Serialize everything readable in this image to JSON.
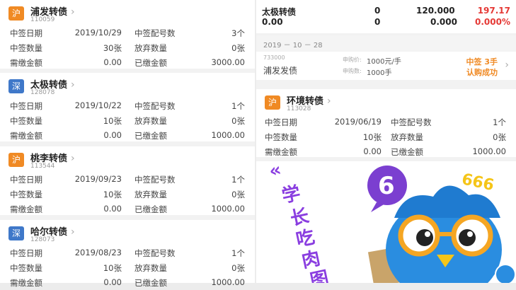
{
  "left_cards": [
    {
      "exchange": "沪",
      "name": "浦发转债",
      "code": "110059",
      "labels": [
        "中签日期",
        "中签配号数",
        "中签数量",
        "放弃数量",
        "需缴金额",
        "已缴金额"
      ],
      "values": [
        "2019/10/29",
        "3个",
        "30张",
        "0张",
        "0.00",
        "3000.00"
      ]
    },
    {
      "exchange": "深",
      "name": "太极转债",
      "code": "128078",
      "labels": [
        "中签日期",
        "中签配号数",
        "中签数量",
        "放弃数量",
        "需缴金额",
        "已缴金额"
      ],
      "values": [
        "2019/10/22",
        "1个",
        "10张",
        "0张",
        "0.00",
        "1000.00"
      ]
    },
    {
      "exchange": "沪",
      "name": "桃李转债",
      "code": "113544",
      "labels": [
        "中签日期",
        "中签配号数",
        "中签数量",
        "放弃数量",
        "需缴金额",
        "已缴金额"
      ],
      "values": [
        "2019/09/23",
        "1个",
        "10张",
        "0张",
        "0.00",
        "1000.00"
      ]
    },
    {
      "exchange": "深",
      "name": "哈尔转债",
      "code": "128073",
      "labels": [
        "中签日期",
        "中签配号数",
        "中签数量",
        "放弃数量",
        "需缴金额",
        "已缴金额"
      ],
      "values": [
        "2019/08/23",
        "1个",
        "10张",
        "0张",
        "0.00",
        "1000.00"
      ]
    }
  ],
  "right_top": {
    "row1": {
      "name": "太极转债",
      "a": "0",
      "b": "120.000",
      "c": "197.17"
    },
    "row2": {
      "name": "0.00",
      "a": "0",
      "b": "0.000",
      "c": "0.000%"
    }
  },
  "date_strip": "2019 － 10 － 28",
  "notice": {
    "code": "733000",
    "name": "浦发发债",
    "price_label": "申购价:",
    "price": "1000元/手",
    "qty_label": "申购数:",
    "qty": "1000手",
    "status1": "中签 3手",
    "status2": "认购成功"
  },
  "right_card": {
    "exchange": "沪",
    "name": "环境转债",
    "code": "113028",
    "labels": [
      "中签日期",
      "中签配号数",
      "中签数量",
      "放弃数量",
      "需缴金额",
      "已缴金额"
    ],
    "values": [
      "2019/06/19",
      "1个",
      "10张",
      "0张",
      "0.00",
      "1000.00"
    ]
  },
  "promo": {
    "title_chars": [
      "学",
      "长",
      "吃",
      "肉",
      "图"
    ],
    "number": "6",
    "number2": "666"
  },
  "colors": {
    "orange": "#f08a24",
    "blue": "#3f78c9",
    "red": "#e53935",
    "promo_purple": "#7b3fd0"
  }
}
